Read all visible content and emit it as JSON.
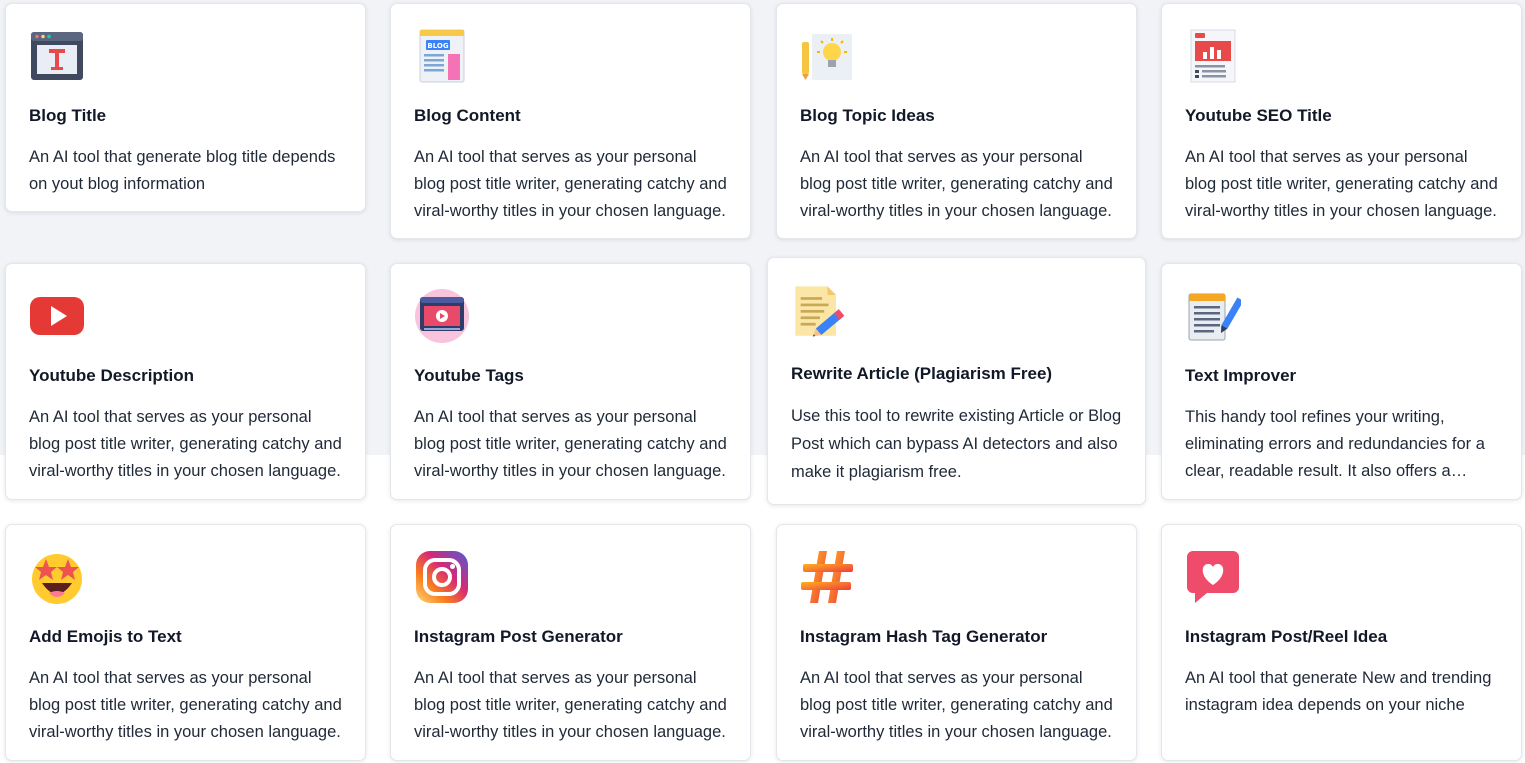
{
  "cards": [
    {
      "title": "Blog Title",
      "description": "An AI tool that generate blog title depends on yout blog information",
      "icon": "blog-title-icon"
    },
    {
      "title": "Blog Content",
      "description": "An AI tool that serves as your personal blog post title writer, generating catchy and viral-worthy titles in your chosen language.",
      "icon": "blog-content-icon"
    },
    {
      "title": "Blog Topic Ideas",
      "description": "An AI tool that serves as your personal blog post title writer, generating catchy and viral-worthy titles in your chosen language.",
      "icon": "lightbulb-icon"
    },
    {
      "title": "Youtube SEO Title",
      "description": "An AI tool that serves as your personal blog post title writer, generating catchy and viral-worthy titles in your chosen language.",
      "icon": "seo-report-icon"
    },
    {
      "title": "Youtube Description",
      "description": "An AI tool that serves as your personal blog post title writer, generating catchy and viral-worthy titles in your chosen language.",
      "icon": "youtube-icon"
    },
    {
      "title": "Youtube Tags",
      "description": "An AI tool that serves as your personal blog post title writer, generating catchy and viral-worthy titles in your chosen language.",
      "icon": "video-player-icon"
    },
    {
      "title": "Rewrite Article (Plagiarism Free)",
      "description": "Use this tool to rewrite existing Article or Blog Post which can bypass AI detectors and also make it plagiarism free.",
      "icon": "document-edit-icon"
    },
    {
      "title": "Text Improver",
      "description": "This handy tool refines your writing, eliminating errors and redundancies for a clear, readable result. It also offers a comprehensive tone analysis.",
      "icon": "notepad-pen-icon"
    },
    {
      "title": "Add Emojis to Text",
      "description": "An AI tool that serves as your personal blog post title writer, generating catchy and viral-worthy titles in your chosen language.",
      "icon": "star-eyes-emoji-icon"
    },
    {
      "title": "Instagram Post Generator",
      "description": "An AI tool that serves as your personal blog post title writer, generating catchy and viral-worthy titles in your chosen language.",
      "icon": "instagram-icon"
    },
    {
      "title": "Instagram Hash Tag Generator",
      "description": "An AI tool that serves as your personal blog post title writer, generating catchy and viral-worthy titles in your chosen language.",
      "icon": "hashtag-icon"
    },
    {
      "title": "Instagram Post/Reel Idea",
      "description": "An AI tool that generate New and trending instagram idea depends on your niche",
      "icon": "heart-bubble-icon"
    }
  ]
}
